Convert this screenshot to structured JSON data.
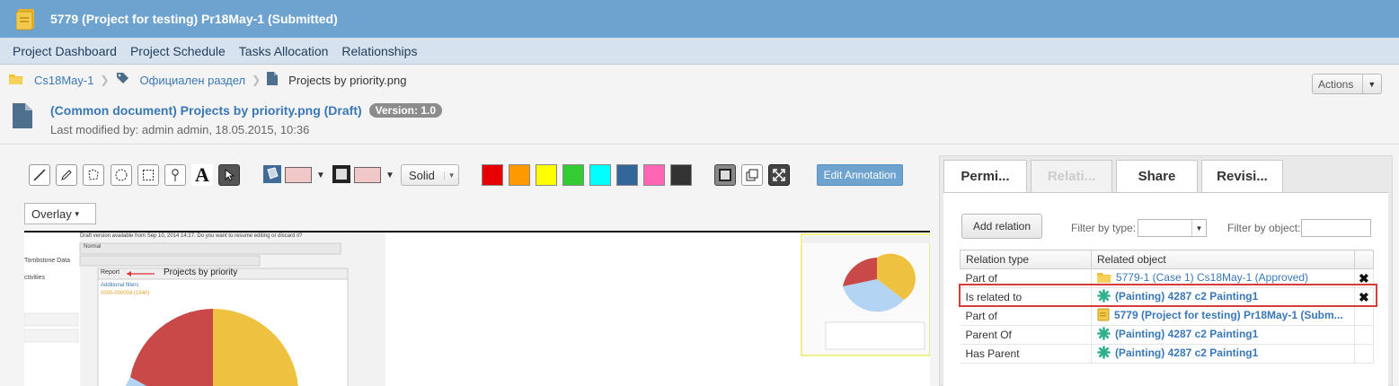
{
  "window": {
    "title": "5779 (Project for testing) Pr18May-1 (Submitted)"
  },
  "nav": [
    "Project Dashboard",
    "Project Schedule",
    "Tasks Allocation",
    "Relationships"
  ],
  "breadcrumb": {
    "root": "Cs18May-1",
    "section": "Официален раздел",
    "file": "Projects by priority.png"
  },
  "actions_label": "Actions",
  "document": {
    "title": "(Common document) Projects by priority.png (Draft)",
    "version": "Version: 1.0",
    "modified": "Last modified by: admin admin, 18.05.2015, 10:36"
  },
  "toolbar": {
    "line_style": "Solid",
    "fill_color": "#f0c8c8",
    "stroke_color": "#f0c8c8",
    "palette": [
      "#e60000",
      "#ff9900",
      "#ffff00",
      "#33cc33",
      "#00ffff",
      "#336699",
      "#ff66b3",
      "#333333"
    ],
    "edit_annotation": "Edit Annotation",
    "overlay": "Overlay"
  },
  "preview": {
    "draft_notice": "Draft version available from Sep 10, 2014 14:27. Do you want to resume editing or discard it?",
    "font_select": "Normal",
    "report_label": "Report",
    "heading": "Projects by priority",
    "filters": "Additional filters",
    "sub": "0000-000004 (1540)",
    "side_labels": [
      "Tombstone Data",
      "ctivities"
    ]
  },
  "panel": {
    "tabs": [
      "Permi...",
      "Relati...",
      "Share",
      "Revisi..."
    ],
    "add_relation": "Add relation",
    "filter_type_label": "Filter by type:",
    "filter_object_label": "Filter by object:",
    "headers": [
      "Relation type",
      "Related object"
    ],
    "rows": [
      {
        "type": "Part of",
        "object": "5779-1 (Case 1) Cs18May-1 (Approved)",
        "icon": "folder-icon",
        "deletable": true
      },
      {
        "type": "Is related to",
        "object": "(Painting) 4287 c2 Painting1",
        "icon": "painting-icon",
        "deletable": true
      },
      {
        "type": "Part of",
        "object": "5779 (Project for testing) Pr18May-1 (Subm...",
        "icon": "project-icon",
        "deletable": false
      },
      {
        "type": "Parent Of",
        "object": "(Painting) 4287 c2 Painting1",
        "icon": "painting-icon",
        "deletable": false
      },
      {
        "type": "Has Parent",
        "object": "(Painting) 4287 c2 Painting1",
        "icon": "painting-icon",
        "deletable": false
      }
    ]
  },
  "colors": {
    "header_bg": "#6fa3cf",
    "nav_bg": "#d6e3ef",
    "link": "#3a78b5",
    "highlight": "#d93a3a"
  }
}
